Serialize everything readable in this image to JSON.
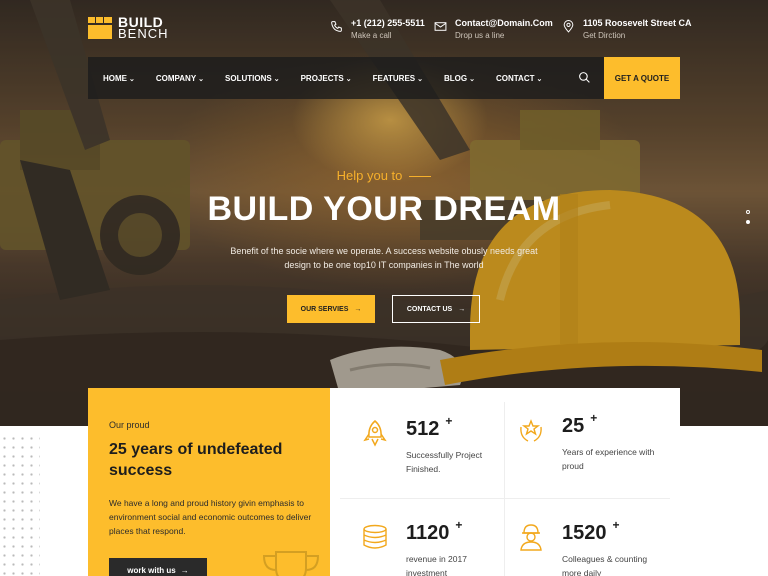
{
  "brand": {
    "name_line1": "BUILD",
    "name_line2": "BENCH",
    "accent": "#fdbd2c"
  },
  "contacts": [
    {
      "icon": "phone-icon",
      "main": "+1 (212) 255-5511",
      "sub": "Make a call"
    },
    {
      "icon": "mail-icon",
      "main": "Contact@Domain.Com",
      "sub": "Drop us a line"
    },
    {
      "icon": "location-icon",
      "main": "1105 Roosevelt Street CA",
      "sub": "Get Dirction"
    }
  ],
  "nav": {
    "items": [
      "HOME",
      "COMPANY",
      "SOLUTIONS",
      "PROJECTS",
      "FEATURES",
      "BLOG",
      "CONTACT"
    ],
    "search_icon": "search-icon",
    "quote_label": "GET A QUOTE"
  },
  "hero": {
    "eyebrow": "Help you to",
    "headline": "BUILD YOUR DREAM",
    "subtext": "Benefit of the socie where we operate. A success website obusly needs great design to be one top10 IT companies in The world",
    "primary_button": "OUR SERVIES",
    "secondary_button": "CONTACT US"
  },
  "about": {
    "eyebrow": "Our proud",
    "title": "25 years of undefeated success",
    "body": "We have a long and proud history givin emphasis to environment social and economic outcomes to deliver places that respond.",
    "button": "work with us"
  },
  "stats": [
    {
      "icon": "rocket-icon",
      "value": "512",
      "plus": "+",
      "label": "Successfully Project Finished."
    },
    {
      "icon": "laurel-star-icon",
      "value": "25",
      "plus": "+",
      "label": "Years of experience with proud"
    },
    {
      "icon": "coins-icon",
      "value": "1120",
      "plus": "+",
      "label": "revenue in 2017 investment"
    },
    {
      "icon": "worker-icon",
      "value": "1520",
      "plus": "+",
      "label": "Colleagues & counting more daily"
    }
  ]
}
